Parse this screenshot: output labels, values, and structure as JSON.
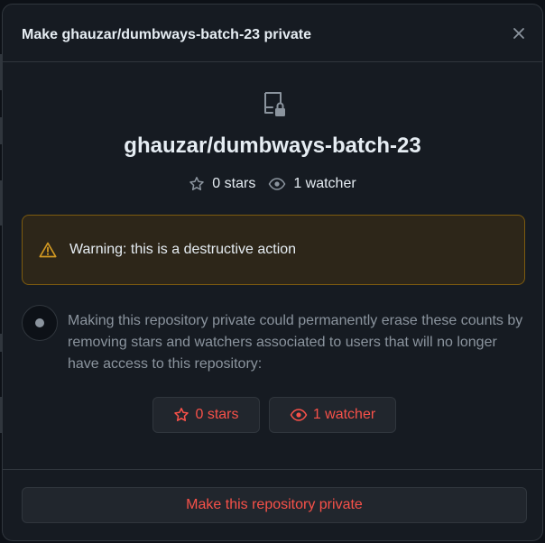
{
  "dialog": {
    "title": "Make ghauzar/dumbways-batch-23 private",
    "close_icon": "close-icon"
  },
  "repo": {
    "icon": "repo-locked-icon",
    "name": "ghauzar/dumbways-batch-23",
    "stars_label": "0 stars",
    "watchers_label": "1 watcher"
  },
  "warning": {
    "icon": "alert-icon",
    "text": "Warning: this is a destructive action"
  },
  "explanation": {
    "text": "Making this repository private could permanently erase these counts by removing stars and watchers associated to users that will no longer have access to this repository:"
  },
  "counts": {
    "stars_label": "0 stars",
    "watchers_label": "1 watcher"
  },
  "footer": {
    "confirm_label": "Make this repository private"
  },
  "colors": {
    "background": "#0d1117",
    "dialog_bg": "#161b22",
    "border": "#30363d",
    "danger": "#f85149",
    "warning_bg": "#2d2619",
    "warning_border": "#7d5b0f",
    "warning_icon": "#d29922",
    "muted_text": "#8b949e"
  }
}
